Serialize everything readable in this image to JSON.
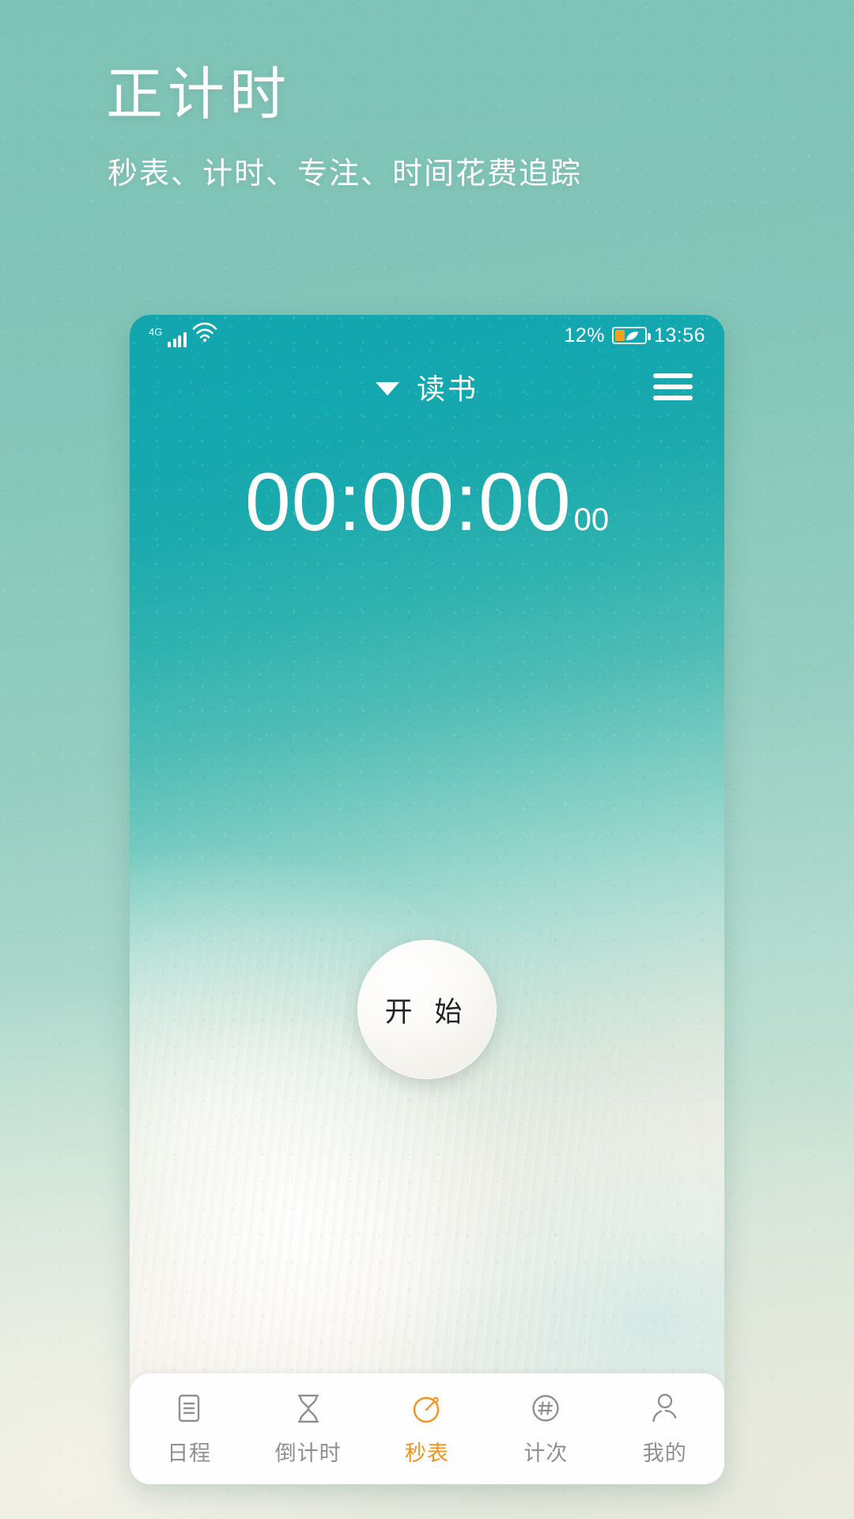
{
  "poster": {
    "title": "正计时",
    "subtitle": "秒表、计时、专注、时间花费追踪",
    "title_color": "#ffffff",
    "background_colors": [
      "#7ec3b6",
      "#95cec1",
      "#dfe6d9"
    ]
  },
  "phone": {
    "status_bar": {
      "network": "4G",
      "signal_icon": "signal-bars-icon",
      "wifi_icon": "wifi-icon",
      "battery_percent": "12%",
      "battery_icon": "battery-eco-icon",
      "battery_fill_color": "#f6a01e",
      "time": "13:56"
    },
    "header": {
      "task_name": "读书",
      "dropdown_icon": "caret-down-icon",
      "menu_icon": "hamburger-menu-icon"
    },
    "stopwatch": {
      "time": "00:00:00",
      "centiseconds": "00",
      "start_label": "开 始"
    },
    "bottom_nav": {
      "active_color": "#f39321",
      "inactive_color": "#8d918f",
      "items": [
        {
          "label": "日程",
          "icon": "schedule-document-icon",
          "active": false
        },
        {
          "label": "倒计时",
          "icon": "hourglass-icon",
          "active": false
        },
        {
          "label": "秒表",
          "icon": "stopwatch-icon",
          "active": true
        },
        {
          "label": "计次",
          "icon": "hash-circle-icon",
          "active": false
        },
        {
          "label": "我的",
          "icon": "person-icon",
          "active": false
        }
      ]
    }
  }
}
